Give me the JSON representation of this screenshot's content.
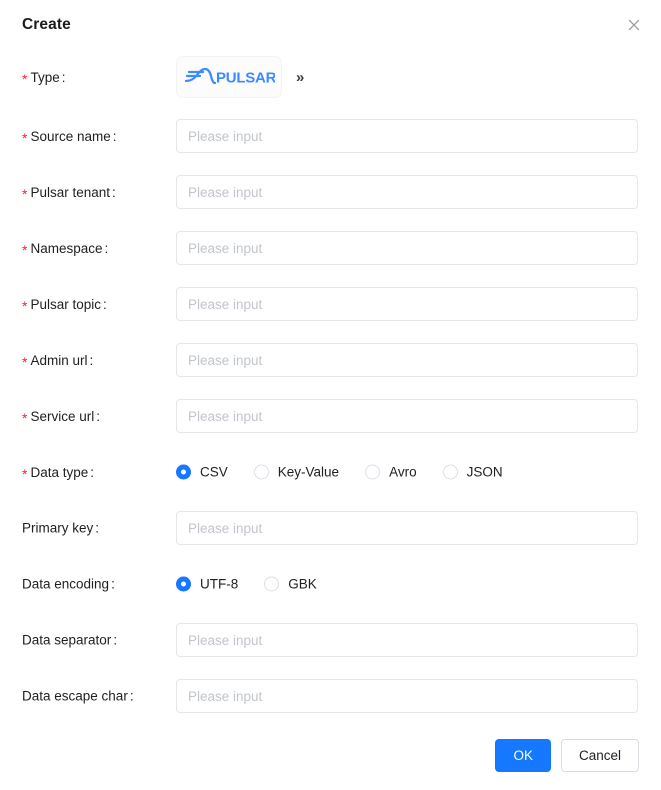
{
  "dialog": {
    "title": "Create",
    "close_icon": "close-icon"
  },
  "type_row": {
    "label": "Type",
    "required": true,
    "selected_type": "PULSAR",
    "logo_text": "PULSAR",
    "more_icon": "»",
    "brand_color": "#3a8bfd"
  },
  "fields": [
    {
      "label": "Source name",
      "required": true,
      "placeholder": "Please input",
      "value": "",
      "name": "source-name"
    },
    {
      "label": "Pulsar tenant",
      "required": true,
      "placeholder": "Please input",
      "value": "",
      "name": "pulsar-tenant"
    },
    {
      "label": "Namespace",
      "required": true,
      "placeholder": "Please input",
      "value": "",
      "name": "namespace"
    },
    {
      "label": "Pulsar topic",
      "required": true,
      "placeholder": "Please input",
      "value": "",
      "name": "pulsar-topic"
    },
    {
      "label": "Admin url",
      "required": true,
      "placeholder": "Please input",
      "value": "",
      "name": "admin-url"
    },
    {
      "label": "Service url",
      "required": true,
      "placeholder": "Please input",
      "value": "",
      "name": "service-url"
    }
  ],
  "data_type": {
    "label": "Data type",
    "required": true,
    "selected": "CSV",
    "options": [
      "CSV",
      "Key-Value",
      "Avro",
      "JSON"
    ]
  },
  "primary_key": {
    "label": "Primary key",
    "required": false,
    "placeholder": "Please input",
    "value": ""
  },
  "data_encoding": {
    "label": "Data encoding",
    "required": false,
    "selected": "UTF-8",
    "options": [
      "UTF-8",
      "GBK"
    ]
  },
  "tail_fields": [
    {
      "label": "Data separator",
      "required": false,
      "placeholder": "Please input",
      "value": "",
      "name": "data-separator"
    },
    {
      "label": "Data escape char",
      "required": false,
      "placeholder": "Please input",
      "value": "",
      "name": "data-escape-char"
    }
  ],
  "footer": {
    "ok_label": "OK",
    "cancel_label": "Cancel",
    "ok_color": "#1677ff"
  },
  "colors": {
    "required_star": "#f5222d",
    "accent": "#1677ff",
    "placeholder": "#c2c6cc",
    "border": "#e4e6ea"
  }
}
